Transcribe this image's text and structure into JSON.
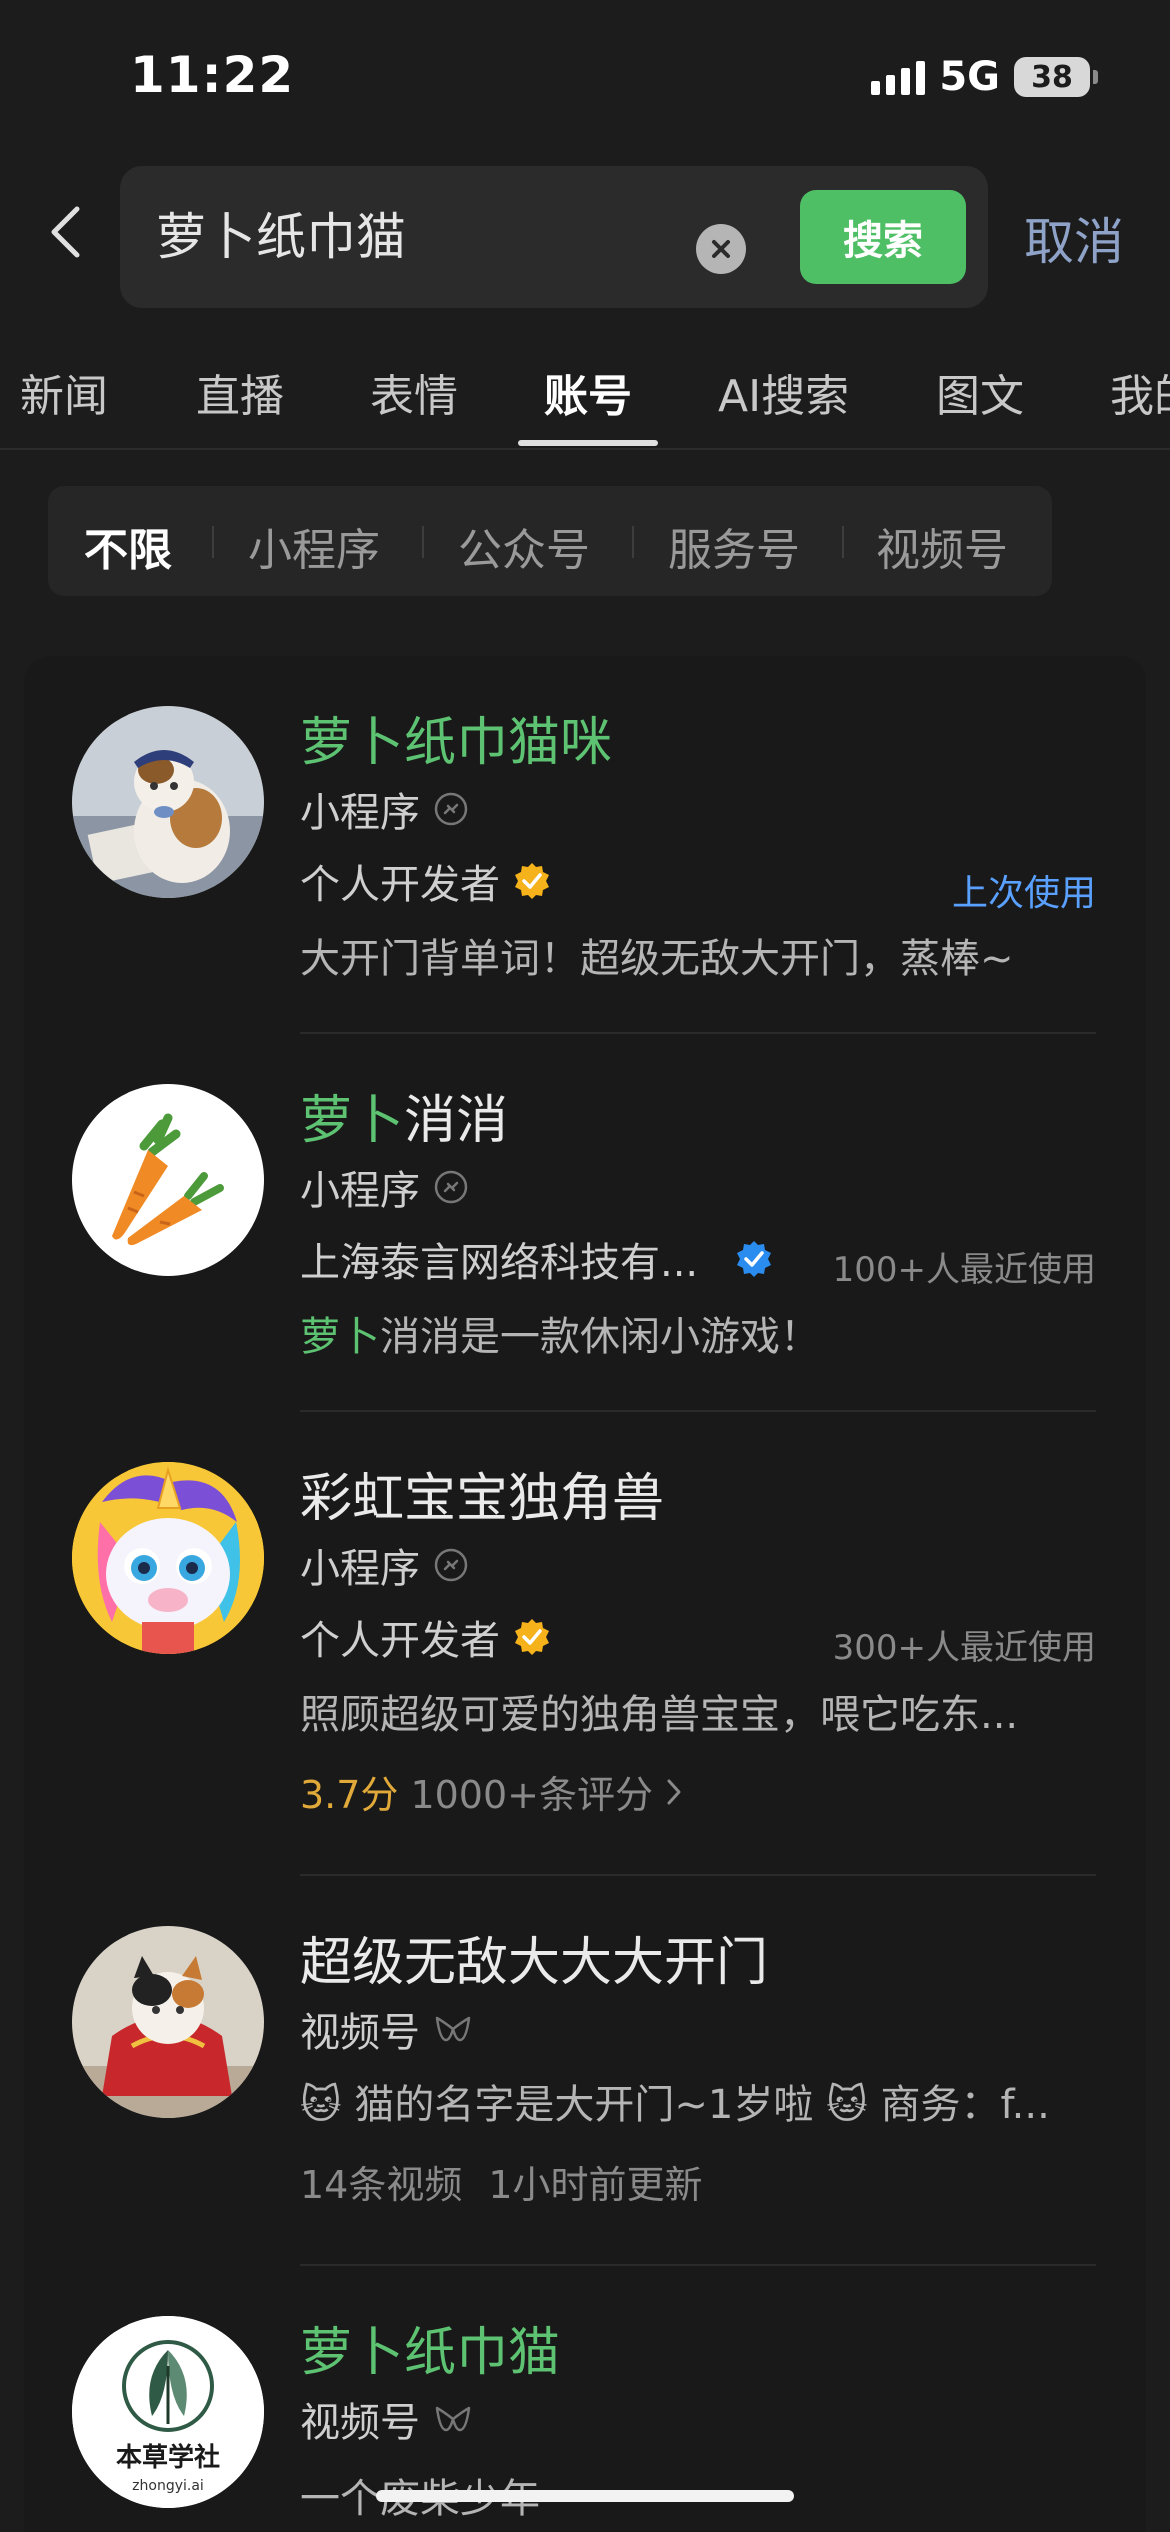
{
  "status_bar": {
    "time": "11:22",
    "network": "5G",
    "battery": "38"
  },
  "search": {
    "query": "萝卜纸巾猫",
    "button_label": "搜索",
    "cancel_label": "取消"
  },
  "tabs": [
    {
      "label": "新闻"
    },
    {
      "label": "直播"
    },
    {
      "label": "表情"
    },
    {
      "label": "账号",
      "active": true
    },
    {
      "label": "AI搜索"
    },
    {
      "label": "图文"
    },
    {
      "label": "我的"
    }
  ],
  "filters": [
    {
      "label": "不限",
      "active": true
    },
    {
      "label": "小程序"
    },
    {
      "label": "公众号"
    },
    {
      "label": "服务号"
    },
    {
      "label": "视频号"
    }
  ],
  "results": [
    {
      "title_hl": "萝卜纸巾猫咪",
      "title_rest": "",
      "type": "小程序",
      "type_icon": "link-icon",
      "owner": "个人开发者",
      "owner_badge": "gold-verified",
      "meta": "上次使用",
      "desc_hl": "",
      "desc": "大开门背单词！超级无敌大开门，蒸棒~"
    },
    {
      "title_hl": "萝卜",
      "title_rest": "消消",
      "type": "小程序",
      "type_icon": "link-icon",
      "owner": "上海泰言网络科技有...",
      "owner_badge": "blue-verified",
      "meta": "100+人最近使用",
      "desc_hl": "萝卜",
      "desc": "消消是一款休闲小游戏！"
    },
    {
      "title_hl": "",
      "title_rest": "彩虹宝宝独角兽",
      "type": "小程序",
      "type_icon": "link-icon",
      "owner": "个人开发者",
      "owner_badge": "gold-verified",
      "meta": "300+人最近使用",
      "desc_hl": "",
      "desc": "照顾超级可爱的独角兽宝宝，喂它吃东...",
      "rating": "3.7分",
      "rating_count": "1000+条评分"
    },
    {
      "title_hl": "",
      "title_rest": "超级无敌大大大开门",
      "type": "视频号",
      "type_icon": "channels-icon",
      "desc_hl": "",
      "desc": "🐱 猫的名字是大开门~1岁啦 🐱 商务：f...",
      "video_count": "14条视频",
      "updated": "1小时前更新"
    },
    {
      "title_hl": "萝卜纸巾猫",
      "title_rest": "",
      "type": "视频号",
      "type_icon": "channels-icon",
      "desc_hl": "",
      "desc": "一个废柴少年",
      "avatar_text": "本草学社",
      "avatar_subtext": "zhongyi.ai"
    }
  ],
  "colors": {
    "accent_green": "#4fbf65",
    "highlight_green": "#5dc372",
    "cancel_blue": "#8fa3c8",
    "rating_gold": "#e1a93a"
  }
}
